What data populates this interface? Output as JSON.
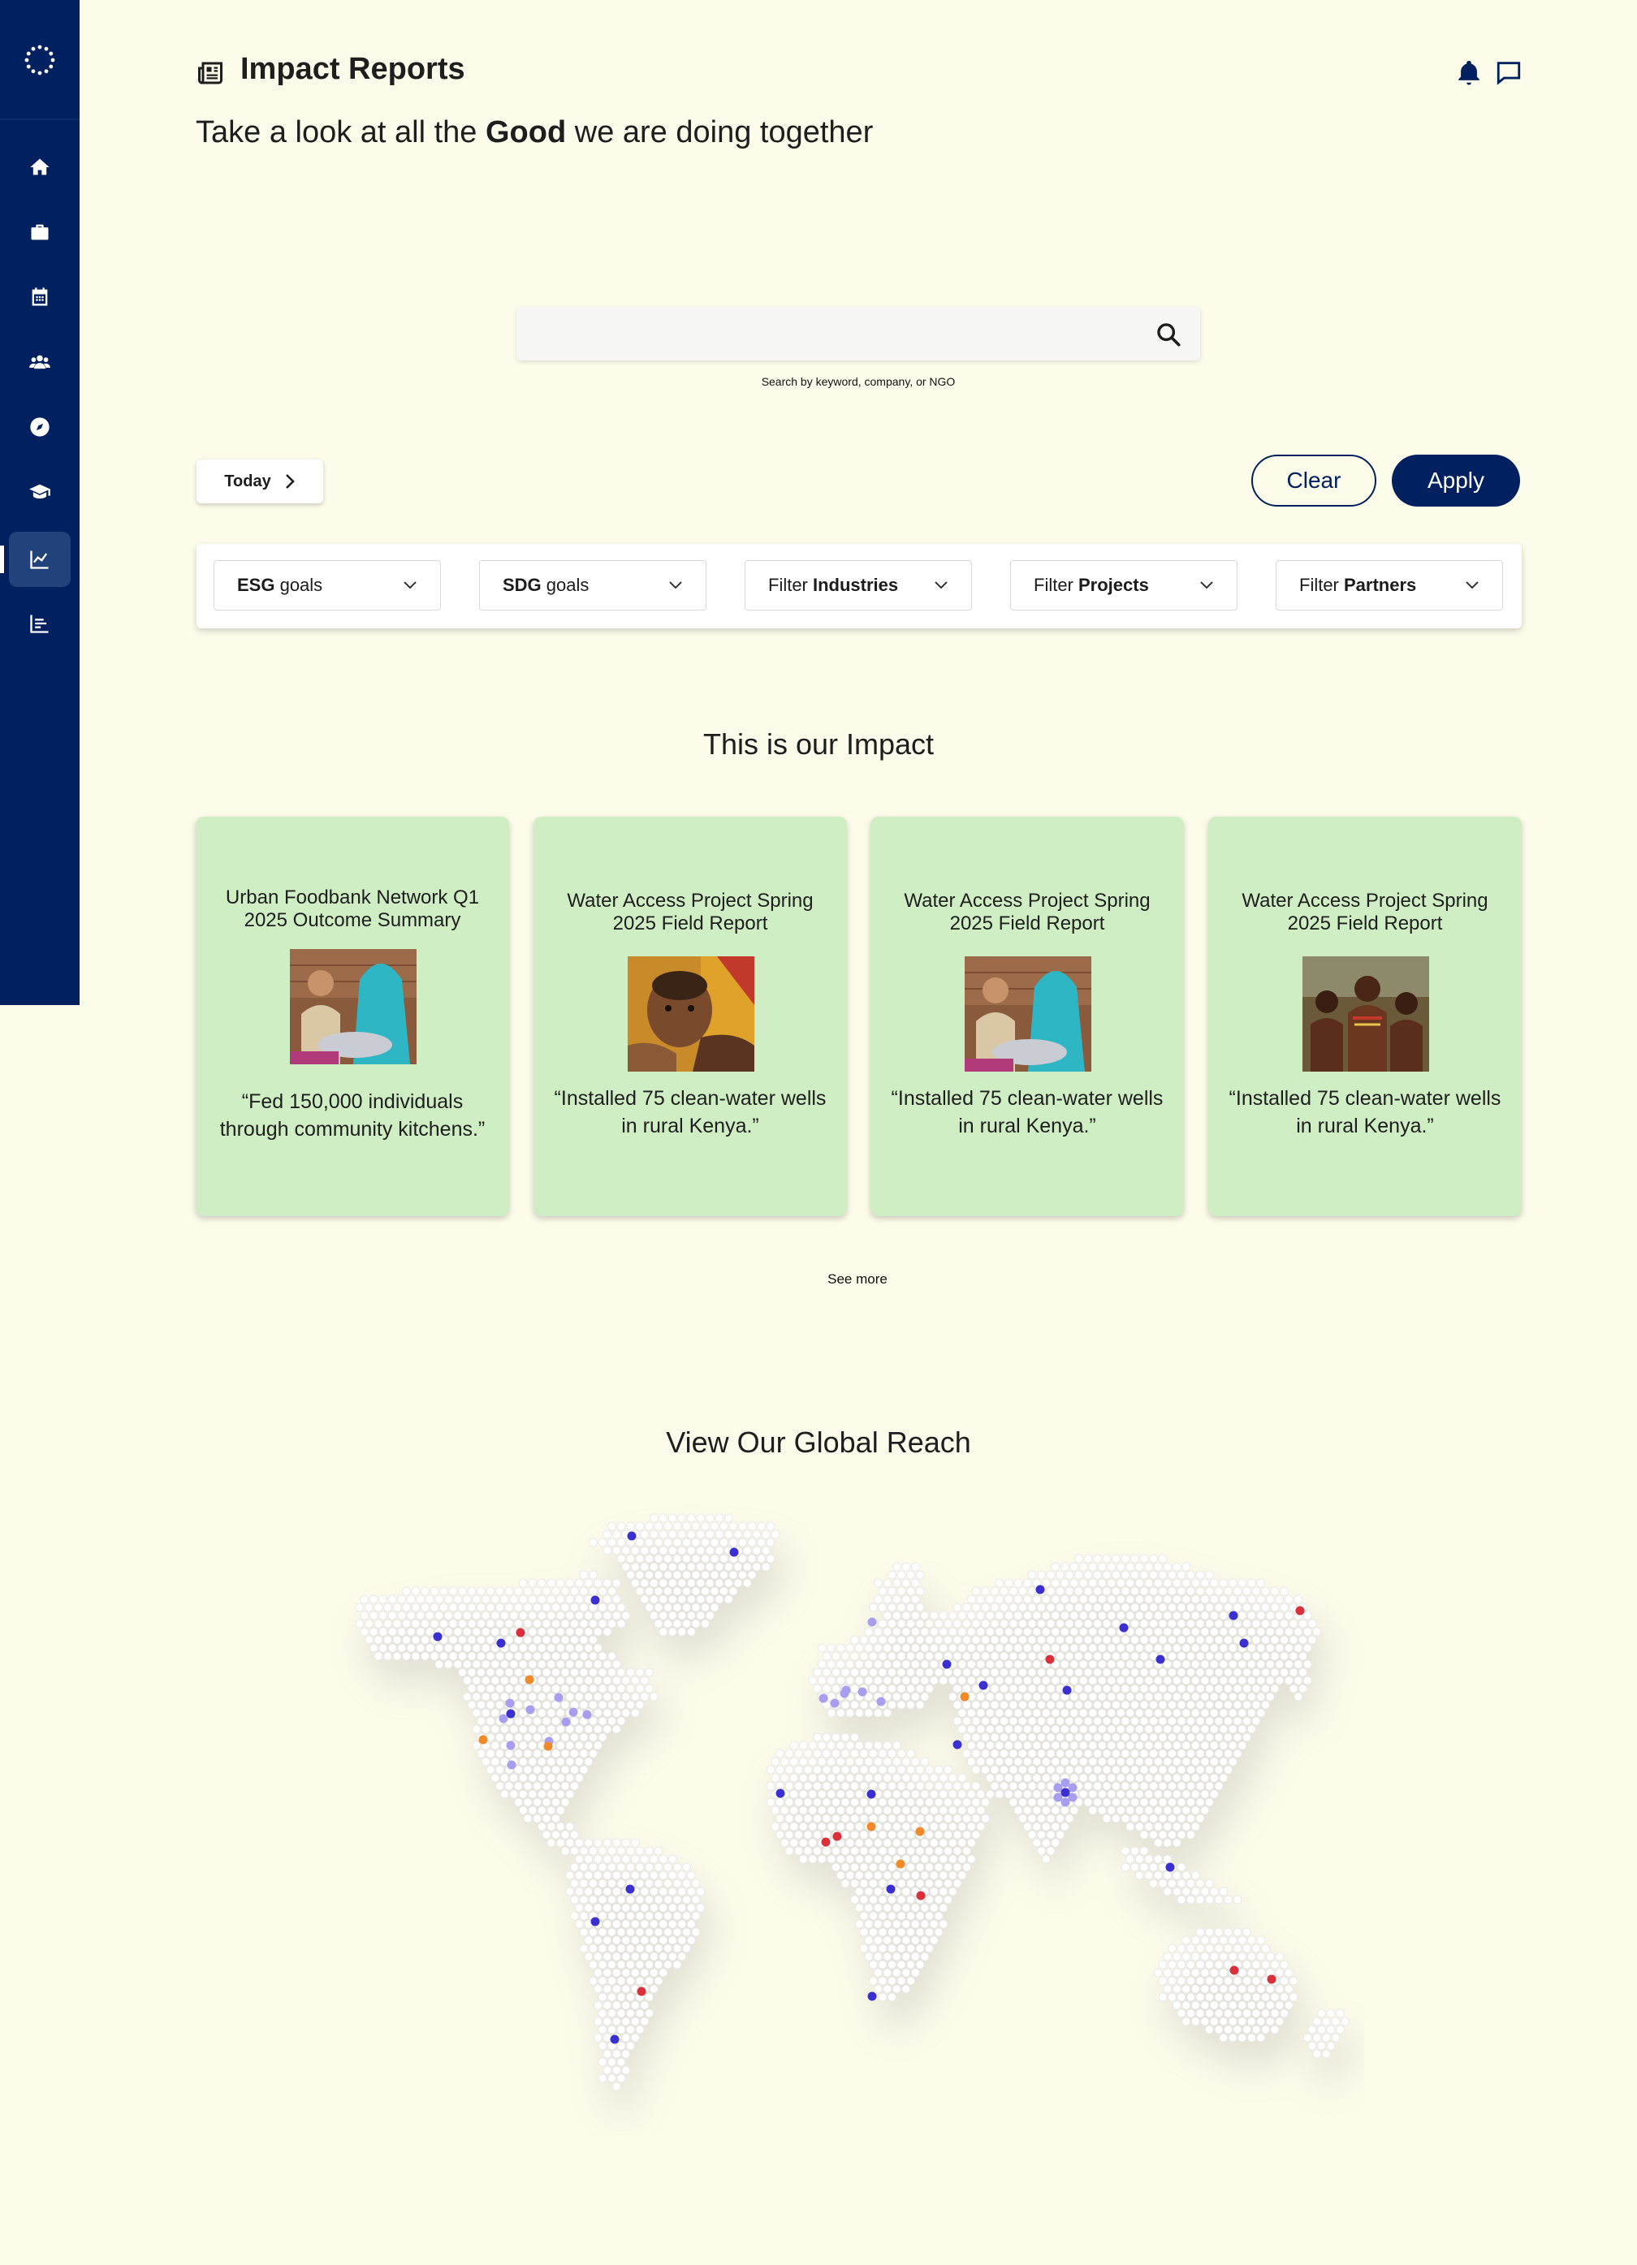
{
  "header": {
    "title": "Impact Reports",
    "subtitle_pre": "Take a look at all the ",
    "subtitle_bold": "Good",
    "subtitle_post": " we are doing together"
  },
  "sidebar": {
    "items": [
      {
        "icon": "home-icon"
      },
      {
        "icon": "briefcase-icon"
      },
      {
        "icon": "calendar-icon"
      },
      {
        "icon": "users-icon"
      },
      {
        "icon": "compass-icon"
      },
      {
        "icon": "graduation-cap-icon"
      },
      {
        "icon": "line-chart-icon",
        "active": true
      },
      {
        "icon": "bar-chart-icon"
      }
    ]
  },
  "search": {
    "value": "",
    "hint": "Search by keyword, company, or NGO"
  },
  "controls": {
    "today_label": "Today",
    "clear_label": "Clear",
    "apply_label": "Apply"
  },
  "filters": [
    {
      "bold": "ESG",
      "rest": " goals"
    },
    {
      "bold": "SDG",
      "rest": " goals"
    },
    {
      "pre": "Filter ",
      "bold": "Industries"
    },
    {
      "pre": "Filter ",
      "bold": "Projects"
    },
    {
      "pre": "Filter ",
      "bold": "Partners"
    }
  ],
  "impact": {
    "title": "This is our Impact",
    "see_more": "See more",
    "cards": [
      {
        "title": "Urban Foodbank Network Q1 2025 Outcome Summary",
        "quote": "“Fed 150,000 individuals through community kitchens.”",
        "image": "photo-elders"
      },
      {
        "title": "Water Access Project Spring 2025 Field Report",
        "quote": "“Installed 75 clean-water wells in rural Kenya.”",
        "image": "photo-child"
      },
      {
        "title": "Water Access Project Spring 2025 Field Report",
        "quote": "“Installed 75 clean-water wells in rural Kenya.”",
        "image": "photo-elders"
      },
      {
        "title": "Water Access Project Spring 2025 Field Report",
        "quote": "“Installed 75 clean-water wells in rural Kenya.”",
        "image": "photo-group"
      }
    ]
  },
  "reach": {
    "title": "View Our Global Reach",
    "colors": {
      "blue": "#3a2fd0",
      "lavender": "#a89ef0",
      "orange": "#f08a2a",
      "red": "#d9303c"
    }
  }
}
